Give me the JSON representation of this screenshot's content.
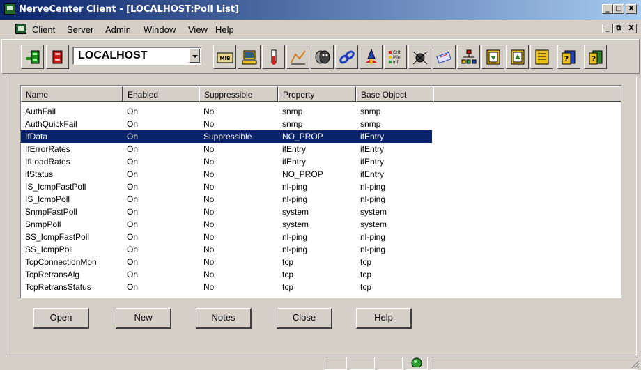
{
  "window": {
    "title": "NerveCenter Client - [LOCALHOST:Poll List]",
    "controls": {
      "minimize": "_",
      "maximize": "□",
      "close": "X"
    }
  },
  "menubar": {
    "items": [
      "Client",
      "Server",
      "Admin",
      "Window",
      "View",
      "Help"
    ],
    "child_controls": {
      "minimize": "_",
      "restore": "⧉",
      "close": "X"
    }
  },
  "toolbar": {
    "server": "LOCALHOST",
    "mib_icon_label": "MIB",
    "severity_icon_label": "Crit\nMin\nInf"
  },
  "table": {
    "columns": [
      "Name",
      "Enabled",
      "Suppressible",
      "Property",
      "Base Object"
    ],
    "rows": [
      [
        "AuthFail",
        "On",
        "No",
        "snmp",
        "snmp"
      ],
      [
        "AuthQuickFail",
        "On",
        "No",
        "snmp",
        "snmp"
      ],
      [
        "IfData",
        "On",
        "Suppressible",
        "NO_PROP",
        "ifEntry"
      ],
      [
        "IfErrorRates",
        "On",
        "No",
        "ifEntry",
        "ifEntry"
      ],
      [
        "IfLoadRates",
        "On",
        "No",
        "ifEntry",
        "ifEntry"
      ],
      [
        "ifStatus",
        "On",
        "No",
        "NO_PROP",
        "ifEntry"
      ],
      [
        "IS_IcmpFastPoll",
        "On",
        "No",
        "nl-ping",
        "nl-ping"
      ],
      [
        "IS_IcmpPoll",
        "On",
        "No",
        "nl-ping",
        "nl-ping"
      ],
      [
        "SnmpFastPoll",
        "On",
        "No",
        "system",
        "system"
      ],
      [
        "SnmpPoll",
        "On",
        "No",
        "system",
        "system"
      ],
      [
        "SS_IcmpFastPoll",
        "On",
        "No",
        "nl-ping",
        "nl-ping"
      ],
      [
        "SS_IcmpPoll",
        "On",
        "No",
        "nl-ping",
        "nl-ping"
      ],
      [
        "TcpConnectionMon",
        "On",
        "No",
        "tcp",
        "tcp"
      ],
      [
        "TcpRetransAlg",
        "On",
        "No",
        "tcp",
        "tcp"
      ],
      [
        "TcpRetransStatus",
        "On",
        "No",
        "tcp",
        "tcp"
      ]
    ],
    "selected_row": 2
  },
  "buttons": {
    "open": "Open",
    "new": "New",
    "notes": "Notes",
    "close": "Close",
    "help": "Help"
  },
  "colors": {
    "selection": "#0a246a",
    "titlebar_start": "#0a246a",
    "titlebar_end": "#a6caf0",
    "status_light": "#2e9e2e"
  }
}
